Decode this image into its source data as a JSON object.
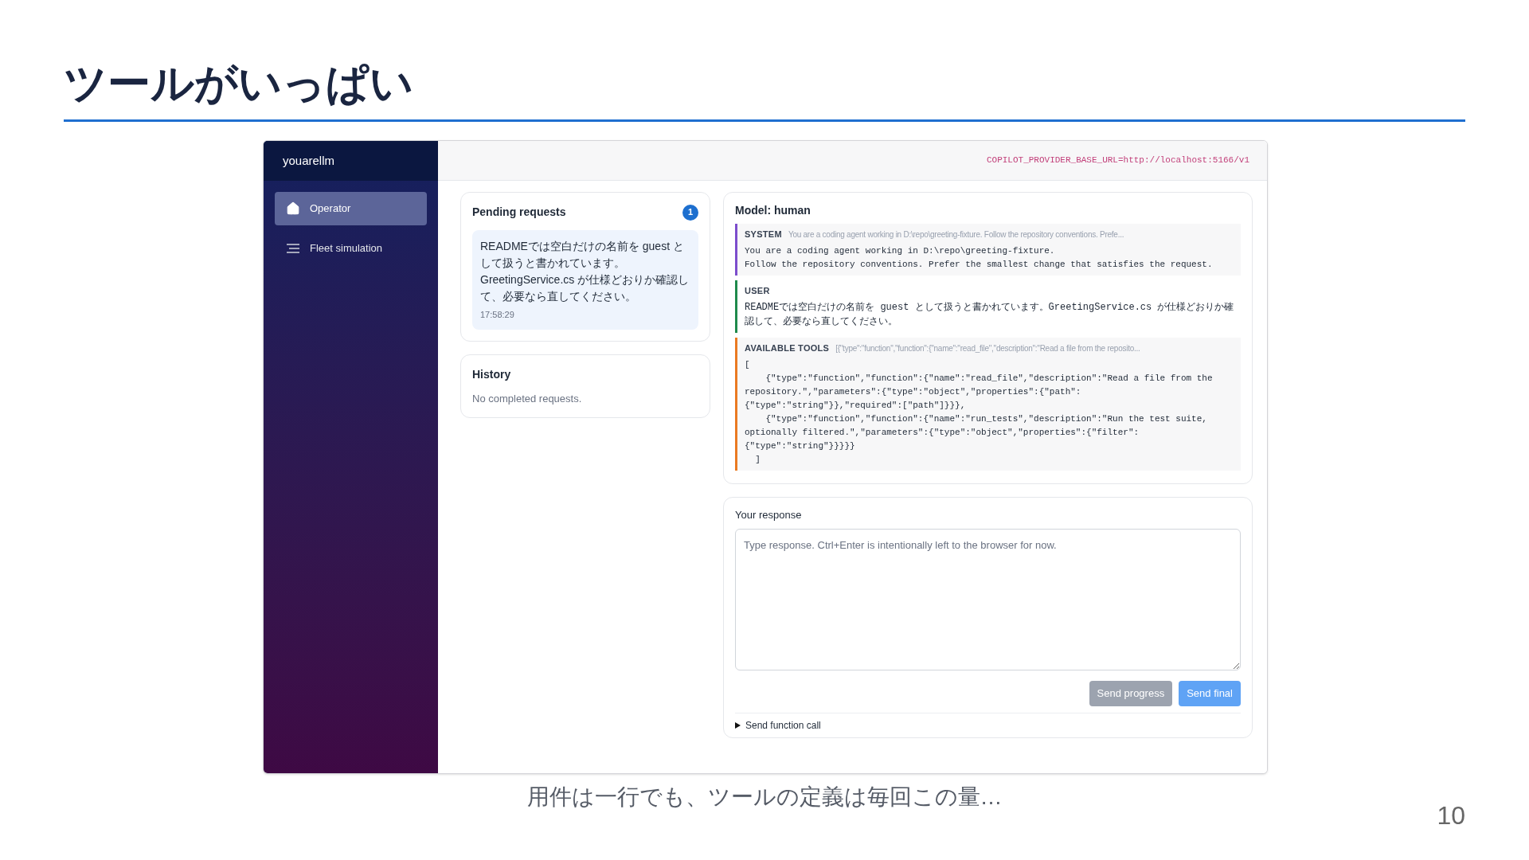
{
  "slide": {
    "title": "ツールがいっぱい",
    "caption": "用件は一行でも、ツールの定義は毎回この量…",
    "page_number": "10"
  },
  "app": {
    "brand": "youarellm",
    "env": "COPILOT_PROVIDER_BASE_URL=http://localhost:5166/v1",
    "nav": [
      {
        "label": "Operator",
        "kind": "home",
        "selected": true
      },
      {
        "label": "Fleet simulation",
        "kind": "list",
        "selected": false
      }
    ],
    "pending": {
      "title": "Pending requests",
      "count": "1",
      "requests": [
        {
          "text": "READMEでは空白だけの名前を guest として扱うと書かれています。GreetingService.cs が仕様どおりか確認して、必要なら直してください。",
          "time": "17:58:29"
        }
      ]
    },
    "history": {
      "title": "History",
      "empty_text": "No completed requests."
    },
    "model": {
      "title": "Model: human",
      "messages": [
        {
          "kind": "system",
          "label": "SYSTEM",
          "color": "#7c4dcc",
          "preview": "You are a coding agent working in D:\\repo\\greeting-fixture. Follow the repository conventions. Prefe...",
          "body": "You are a coding agent working in D:\\repo\\greeting-fixture.\nFollow the repository conventions. Prefer the smallest change that satisfies the request."
        },
        {
          "kind": "user",
          "label": "USER",
          "color": "#1f8a4c",
          "body": "READMEでは空白だけの名前を guest として扱うと書かれています。GreetingService.cs が仕様どおりか確認して、必要なら直してください。"
        },
        {
          "kind": "tools",
          "label": "AVAILABLE TOOLS",
          "color": "#ea7a22",
          "preview": "[{\"type\":\"function\",\"function\":{\"name\":\"read_file\",\"description\":\"Read a file from the reposito...",
          "body": "[\n    {\"type\":\"function\",\"function\":{\"name\":\"read_file\",\"description\":\"Read a file from the\nrepository.\",\"parameters\":{\"type\":\"object\",\"properties\":{\"path\":\n{\"type\":\"string\"}},\"required\":[\"path\"]}}},\n    {\"type\":\"function\",\"function\":{\"name\":\"run_tests\",\"description\":\"Run the test suite,\noptionally filtered.\",\"parameters\":{\"type\":\"object\",\"properties\":{\"filter\":\n{\"type\":\"string\"}}}}}\n  ]"
        }
      ]
    },
    "response": {
      "label": "Your response",
      "placeholder": "Type response. Ctrl+Enter is intentionally left to the browser for now.",
      "buttons": [
        {
          "label": "Send progress",
          "kind": "secondary"
        },
        {
          "label": "Send final",
          "kind": "primary"
        }
      ],
      "function_call": {
        "label": "Send function call",
        "expanded": false
      }
    }
  }
}
